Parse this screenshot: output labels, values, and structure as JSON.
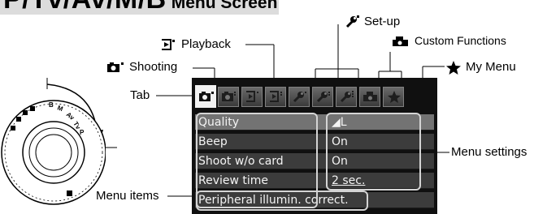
{
  "title": {
    "main": "P/Tv/Av/M/B",
    "suffix": "Menu Screen"
  },
  "callouts": {
    "shooting": "Shooting",
    "playback": "Playback",
    "setup": "Set-up",
    "custom_functions": "Custom Functions",
    "my_menu": "My Menu",
    "tab": "Tab",
    "menu_items": "Menu items",
    "menu_settings": "Menu settings"
  },
  "dial_labels": [
    "B",
    "M",
    "Av",
    "Tv",
    "P"
  ],
  "menu": {
    "tabs": [
      {
        "name": "shooting-1",
        "icon": "camera-icon",
        "active": true
      },
      {
        "name": "shooting-2",
        "icon": "camera-icon"
      },
      {
        "name": "playback-1",
        "icon": "playback-icon"
      },
      {
        "name": "playback-2",
        "icon": "playback-icon"
      },
      {
        "name": "setup-1",
        "icon": "wrench-icon"
      },
      {
        "name": "setup-2",
        "icon": "wrench-icon"
      },
      {
        "name": "setup-3",
        "icon": "wrench-icon"
      },
      {
        "name": "custom-functions",
        "icon": "custom-functions-icon"
      },
      {
        "name": "my-menu",
        "icon": "star-icon"
      }
    ],
    "rows": [
      {
        "item": "Quality",
        "value": "◢L"
      },
      {
        "item": "Beep",
        "value": "On"
      },
      {
        "item": "Shoot w/o card",
        "value": "On"
      },
      {
        "item": "Review time",
        "value": "2 sec."
      },
      {
        "item": "Peripheral illumin. correct.",
        "value": ""
      }
    ]
  },
  "colors": {
    "title_band": "#dcdcdc",
    "screen_bg": "#101010",
    "row_bg": "#3c3c3c",
    "row_highlight": "#737373",
    "tab_active": "#f2f2f2",
    "outline": "#d4d4d4"
  }
}
